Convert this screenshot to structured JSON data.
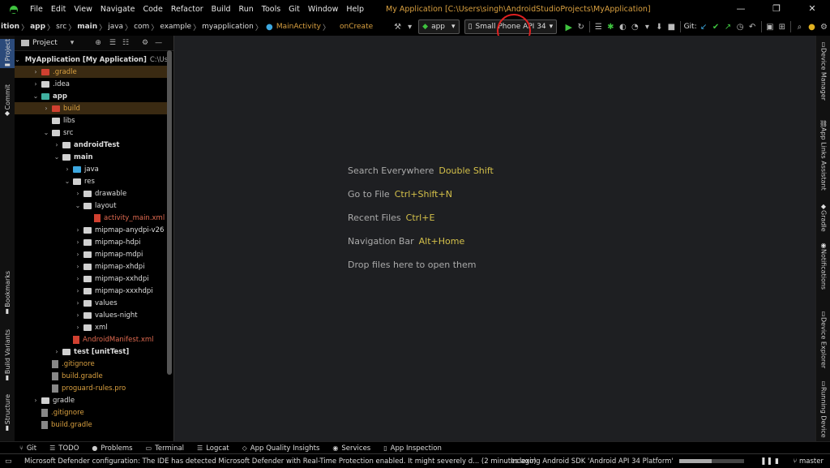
{
  "menu": {
    "items": [
      "File",
      "Edit",
      "View",
      "Navigate",
      "Code",
      "Refactor",
      "Build",
      "Run",
      "Tools",
      "Git",
      "Window",
      "Help"
    ],
    "title": "My Application [C:\\Users\\singh\\AndroidStudioProjects\\MyApplication]"
  },
  "breadcrumb": [
    "ition",
    "app",
    "src",
    "main",
    "java",
    "com",
    "example",
    "myapplication"
  ],
  "toolbar": {
    "tab_main_activity": "MainActivity",
    "on_create": "onCreate",
    "run_config": "app",
    "device": "Small Phone API 34",
    "git_label": "Git:"
  },
  "project_panel": {
    "header": "Project",
    "tree": [
      {
        "label": "MyApplication [My Application]",
        "extra": "C:\\Use",
        "indent": 0,
        "chev": "v",
        "icon": "folder-teal",
        "style": "bold",
        "hl": false
      },
      {
        "label": ".gradle",
        "indent": 1,
        "chev": ">",
        "icon": "folder-red",
        "style": "orange",
        "hl": true
      },
      {
        "label": ".idea",
        "indent": 1,
        "chev": ">",
        "icon": "folder",
        "style": "",
        "hl": false
      },
      {
        "label": "app",
        "indent": 1,
        "chev": "v",
        "icon": "folder-teal",
        "style": "bold",
        "hl": false
      },
      {
        "label": "build",
        "indent": 2,
        "chev": ">",
        "icon": "folder-red",
        "style": "orange",
        "hl": true
      },
      {
        "label": "libs",
        "indent": 2,
        "chev": "",
        "icon": "folder",
        "style": "",
        "hl": false
      },
      {
        "label": "src",
        "indent": 2,
        "chev": "v",
        "icon": "folder",
        "style": "",
        "hl": false
      },
      {
        "label": "androidTest",
        "indent": 3,
        "chev": ">",
        "icon": "folder",
        "style": "bold",
        "hl": false
      },
      {
        "label": "main",
        "indent": 3,
        "chev": "v",
        "icon": "folder",
        "style": "bold",
        "hl": false
      },
      {
        "label": "java",
        "indent": 4,
        "chev": ">",
        "icon": "folder-blue",
        "style": "",
        "hl": false
      },
      {
        "label": "res",
        "indent": 4,
        "chev": "v",
        "icon": "folder",
        "style": "",
        "hl": false
      },
      {
        "label": "drawable",
        "indent": 5,
        "chev": ">",
        "icon": "folder",
        "style": "",
        "hl": false
      },
      {
        "label": "layout",
        "indent": 5,
        "chev": "v",
        "icon": "folder",
        "style": "",
        "hl": false
      },
      {
        "label": "activity_main.xml",
        "indent": 6,
        "chev": "",
        "icon": "file-xml",
        "style": "red",
        "hl": false
      },
      {
        "label": "mipmap-anydpi-v26",
        "indent": 5,
        "chev": ">",
        "icon": "folder",
        "style": "",
        "hl": false
      },
      {
        "label": "mipmap-hdpi",
        "indent": 5,
        "chev": ">",
        "icon": "folder",
        "style": "",
        "hl": false
      },
      {
        "label": "mipmap-mdpi",
        "indent": 5,
        "chev": ">",
        "icon": "folder",
        "style": "",
        "hl": false
      },
      {
        "label": "mipmap-xhdpi",
        "indent": 5,
        "chev": ">",
        "icon": "folder",
        "style": "",
        "hl": false
      },
      {
        "label": "mipmap-xxhdpi",
        "indent": 5,
        "chev": ">",
        "icon": "folder",
        "style": "",
        "hl": false
      },
      {
        "label": "mipmap-xxxhdpi",
        "indent": 5,
        "chev": ">",
        "icon": "folder",
        "style": "",
        "hl": false
      },
      {
        "label": "values",
        "indent": 5,
        "chev": ">",
        "icon": "folder",
        "style": "",
        "hl": false
      },
      {
        "label": "values-night",
        "indent": 5,
        "chev": ">",
        "icon": "folder",
        "style": "",
        "hl": false
      },
      {
        "label": "xml",
        "indent": 5,
        "chev": ">",
        "icon": "folder",
        "style": "",
        "hl": false
      },
      {
        "label": "AndroidManifest.xml",
        "indent": 4,
        "chev": "",
        "icon": "file-xml",
        "style": "red",
        "hl": false
      },
      {
        "label": "test [unitTest]",
        "indent": 3,
        "chev": ">",
        "icon": "folder",
        "style": "bold",
        "hl": false
      },
      {
        "label": ".gitignore",
        "indent": 2,
        "chev": "",
        "icon": "file",
        "style": "orange",
        "hl": false
      },
      {
        "label": "build.gradle",
        "indent": 2,
        "chev": "",
        "icon": "file",
        "style": "orange",
        "hl": false
      },
      {
        "label": "proguard-rules.pro",
        "indent": 2,
        "chev": "",
        "icon": "file",
        "style": "orange",
        "hl": false
      },
      {
        "label": "gradle",
        "indent": 1,
        "chev": ">",
        "icon": "folder",
        "style": "",
        "hl": false
      },
      {
        "label": ".gitignore",
        "indent": 1,
        "chev": "",
        "icon": "file",
        "style": "orange",
        "hl": false
      },
      {
        "label": "build.gradle",
        "indent": 1,
        "chev": "",
        "icon": "file",
        "style": "orange",
        "hl": false
      }
    ]
  },
  "left_strip": {
    "project": "Project",
    "commit": "Commit",
    "bookmarks": "Bookmarks",
    "build_variants": "Build Variants",
    "structure": "Structure"
  },
  "right_strip": {
    "device_manager": "Device Manager",
    "app_links": "App Links Assistant",
    "gradle": "Gradle",
    "notifications": "Notifications",
    "device_explorer": "Device Explorer",
    "running_devices": "Running Device"
  },
  "editor_hints": [
    {
      "text": "Search Everywhere",
      "key": "Double Shift"
    },
    {
      "text": "Go to File",
      "key": "Ctrl+Shift+N"
    },
    {
      "text": "Recent Files",
      "key": "Ctrl+E"
    },
    {
      "text": "Navigation Bar",
      "key": "Alt+Home"
    },
    {
      "text": "Drop files here to open them",
      "key": ""
    }
  ],
  "bottom_tabs": [
    "Git",
    "TODO",
    "Problems",
    "Terminal",
    "Logcat",
    "App Quality Insights",
    "Services",
    "App Inspection"
  ],
  "status": {
    "message": "Microsoft Defender configuration: The IDE has detected Microsoft Defender with Real-Time Protection enabled. It might severely d... (2 minutes ago)",
    "indexing": "Indexing Android SDK 'Android API 34 Platform'",
    "branch": "master"
  },
  "colors": {
    "accent_orange": "#d9a040",
    "run_green": "#3fc33f",
    "highlight_red": "#e02020",
    "key_yellow": "#d4c04a"
  }
}
